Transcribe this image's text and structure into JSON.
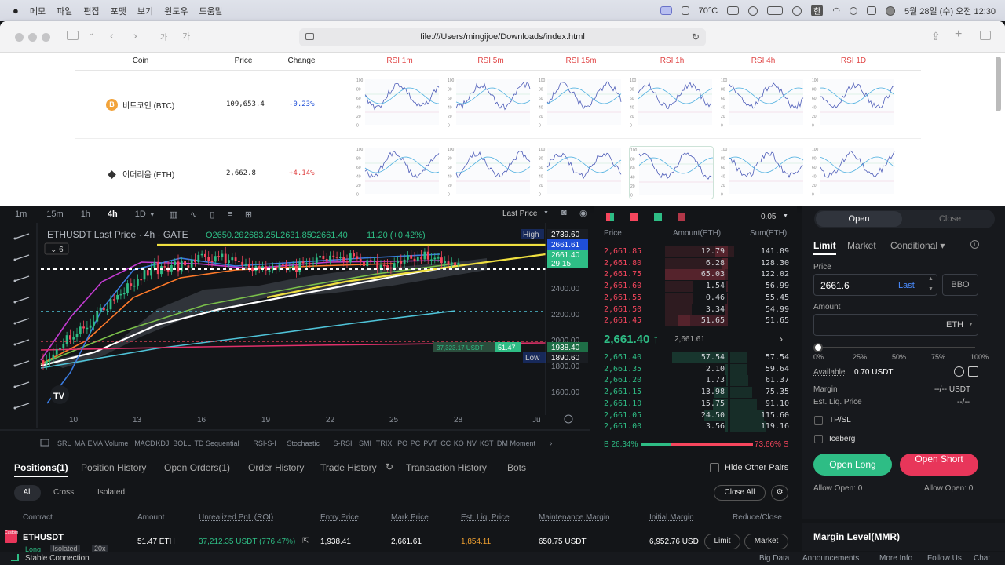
{
  "menubar": {
    "items": [
      "메모",
      "파일",
      "편집",
      "포맷",
      "보기",
      "윈도우",
      "도움말"
    ],
    "temperature": "70°C",
    "datetime": "5월 28일 (수) 오전 12:30",
    "input_method": "한"
  },
  "browser": {
    "url": "file:///Users/mingijoe/Downloads/index.html",
    "text_size_small": "가",
    "text_size_large": "가"
  },
  "rsi_table": {
    "headers": {
      "coin": "Coin",
      "price": "Price",
      "change": "Change",
      "rsi": [
        "RSI 1m",
        "RSI 5m",
        "RSI 15m",
        "RSI 1h",
        "RSI 4h",
        "RSI 1D"
      ]
    },
    "rows": [
      {
        "icon": "B",
        "name": "비트코인 (BTC)",
        "price": "109,653.4",
        "change": "-0.23%",
        "change_color": "#1f4fd8"
      },
      {
        "icon": "◆",
        "name": "이더리움 (ETH)",
        "price": "2,662.8",
        "change": "+4.14%",
        "change_color": "#e04545"
      }
    ],
    "axis_ticks": [
      "100",
      "80",
      "60",
      "40",
      "20",
      "0"
    ]
  },
  "timeframes": {
    "items": [
      "1m",
      "15m",
      "1h",
      "4h",
      "1D"
    ],
    "selected": "4h",
    "last_price_label": "Last Price"
  },
  "chart": {
    "symbol_line": "ETHUSDT Last Price · 4h · GATE",
    "o": "O2650.20",
    "h": "H2683.25",
    "l": "L2631.85",
    "c": "C2661.40",
    "chg": "11.20 (+0.42%)",
    "indicator_count": "6",
    "price_axis": [
      "2400.00",
      "2200.00",
      "2000.00",
      "1800.00",
      "1600.00"
    ],
    "tags": {
      "high_label": "High",
      "high_val": "2739.60",
      "last_val": "2661.61",
      "cur_val": "2661.40",
      "countdown": "29:15",
      "entry_val": "1938.40",
      "low_label": "Low",
      "low_val": "1890.60"
    },
    "position_tag": "37,323.17 USDT",
    "position_size": "51.47",
    "date_axis": [
      "10",
      "13",
      "16",
      "19",
      "22",
      "25",
      "28",
      "Ju"
    ],
    "indicators": [
      "SRL",
      "MA",
      "EMA",
      "Volume",
      "MACD",
      "KDJ",
      "BOLL",
      "TD Sequential",
      "RSI-S-I",
      "Stochastic",
      "S-RSI",
      "SMI",
      "TRIX",
      "PO",
      "PC",
      "PVT",
      "CC",
      "KO",
      "NV",
      "KST",
      "DM",
      "Moment"
    ]
  },
  "orderbook": {
    "precision": "0.05",
    "headers": {
      "price": "Price",
      "amount": "Amount(ETH)",
      "sum": "Sum(ETH)"
    },
    "asks": [
      {
        "price": "2,661.85",
        "amount": "12.79",
        "sum": "141.09"
      },
      {
        "price": "2,661.80",
        "amount": "6.28",
        "sum": "128.30"
      },
      {
        "price": "2,661.75",
        "amount": "65.03",
        "sum": "122.02"
      },
      {
        "price": "2,661.60",
        "amount": "1.54",
        "sum": "56.99"
      },
      {
        "price": "2,661.55",
        "amount": "0.46",
        "sum": "55.45"
      },
      {
        "price": "2,661.50",
        "amount": "3.34",
        "sum": "54.99"
      },
      {
        "price": "2,661.45",
        "amount": "51.65",
        "sum": "51.65"
      }
    ],
    "last_price": "2,661.40 ↑",
    "mark_price": "2,661.61",
    "bids": [
      {
        "price": "2,661.40",
        "amount": "57.54",
        "sum": "57.54"
      },
      {
        "price": "2,661.35",
        "amount": "2.10",
        "sum": "59.64"
      },
      {
        "price": "2,661.20",
        "amount": "1.73",
        "sum": "61.37"
      },
      {
        "price": "2,661.15",
        "amount": "13.98",
        "sum": "75.35"
      },
      {
        "price": "2,661.10",
        "amount": "15.75",
        "sum": "91.10"
      },
      {
        "price": "2,661.05",
        "amount": "24.50",
        "sum": "115.60"
      },
      {
        "price": "2,661.00",
        "amount": "3.56",
        "sum": "119.16"
      }
    ],
    "buy_pct": "B 26.34%",
    "sell_pct": "73.66% S"
  },
  "trade": {
    "open_tab": "Open",
    "close_tab": "Close",
    "order_types": [
      "Limit",
      "Market",
      "Conditional ▾"
    ],
    "price_label": "Price",
    "price_value": "2661.6",
    "last_btn": "Last",
    "bbo_btn": "BBO",
    "amount_label": "Amount",
    "amount_unit": "ETH",
    "slider_marks": [
      "0%",
      "25%",
      "50%",
      "75%",
      "100%"
    ],
    "available_label": "Available",
    "available_value": "0.70 USDT",
    "margin_label": "Margin",
    "margin_value": "--/-- USDT",
    "liq_label": "Est. Liq. Price",
    "liq_value": "--/--",
    "tpsl": "TP/SL",
    "iceberg": "Iceberg",
    "open_long": "Open Long",
    "open_short": "Open Short",
    "allow_open_long": "Allow Open: 0",
    "allow_open_short": "Allow Open: 0",
    "margin_level": "Margin Level(MMR)"
  },
  "positions": {
    "tabs": [
      "Positions(1)",
      "Position History",
      "Open Orders(1)",
      "Order History",
      "Trade History",
      "Transaction History",
      "Bots"
    ],
    "hide_other": "Hide Other Pairs",
    "filters": [
      "All",
      "Cross",
      "Isolated"
    ],
    "close_all": "Close All",
    "columns": [
      "Contract",
      "Amount",
      "Unrealized PnL (ROI)",
      "Entry Price",
      "Mark Price",
      "Est. Liq. Price",
      "Maintenance Margin",
      "Initial Margin",
      "Reduce/Close"
    ],
    "row": {
      "contract": "ETHUSDT",
      "side": "Long",
      "mode": "Isolated",
      "leverage": "20x",
      "amount": "51.47 ETH",
      "pnl": "37,212.35 USDT (776.47%)",
      "entry": "1,938.41",
      "mark": "2,661.61",
      "liq": "1,854.11",
      "mm": "650.75 USDT",
      "im": "6,952.76 USD",
      "limit": "Limit",
      "market": "Market"
    }
  },
  "footer": {
    "status": "Stable Connection",
    "links": [
      "Big Data",
      "Announcements",
      "More Info",
      "Follow Us",
      "Chat"
    ]
  },
  "colors": {
    "green": "#2ebd85",
    "red": "#f6465d",
    "yellow": "#f0e040",
    "bg": "#131518"
  }
}
